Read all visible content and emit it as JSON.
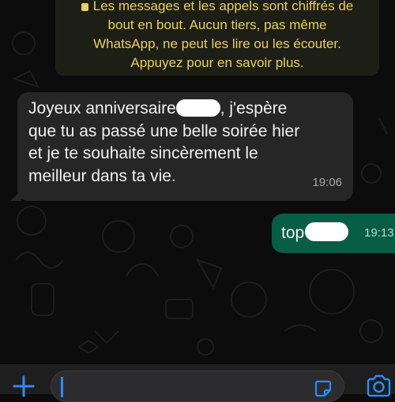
{
  "encryption_banner": {
    "lines": [
      "Les messages et les appels sont chiffrés de",
      "bout en bout. Aucun tiers, pas même",
      "WhatsApp, ne peut les lire ou les écouter.",
      "Appuyez pour en savoir plus."
    ],
    "icon": "lock-icon"
  },
  "messages": [
    {
      "direction": "incoming",
      "lines": [
        "Joyeux anniversaire",
        ", j'espère",
        "que tu as passé une belle soirée hier",
        "et je te souhaite sincèrement le",
        "meilleur dans ta vie."
      ],
      "time": "19:06"
    },
    {
      "direction": "outgoing",
      "text": "top",
      "time": "19:13"
    }
  ],
  "composer": {
    "left_icon": "plus-icon",
    "sticker_icon": "sticker-icon",
    "right_icon": "camera-icon"
  },
  "colors": {
    "background": "#0b0c0b",
    "banner_text": "#e9cf62",
    "incoming_bubble": "#262626",
    "outgoing_bubble": "#075e45",
    "caret": "#2e8bfa"
  }
}
